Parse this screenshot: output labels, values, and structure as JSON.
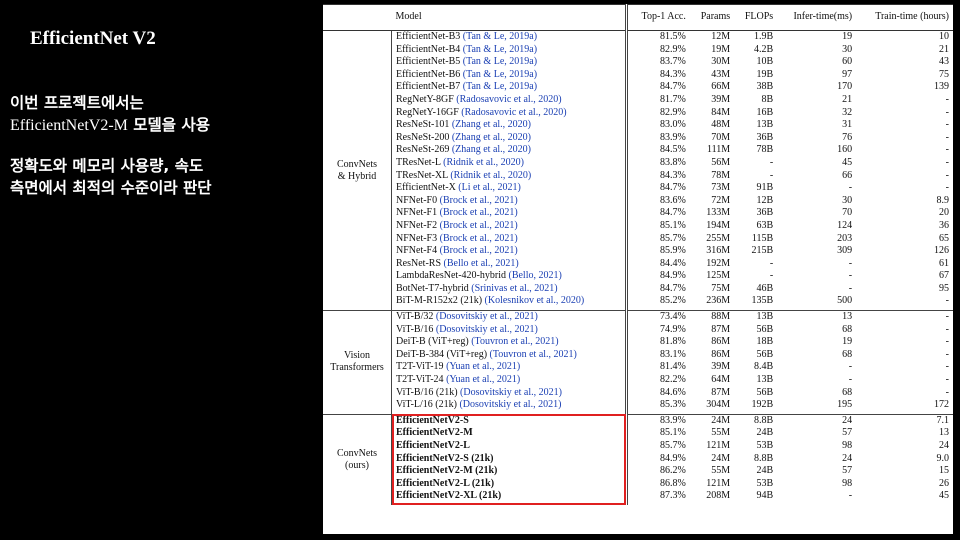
{
  "slide": {
    "title": "EfficientNet V2",
    "bullet1_line1": "이번 프로젝트에서는",
    "bullet1_model": "EfficientNetV2-M",
    "bullet1_rest": " 모델을 사용",
    "bullet2_line1": "정확도와 메모리 사용량, 속도",
    "bullet2_line2": "측면에서 최적의 수준이라 판단"
  },
  "table": {
    "headers": [
      "Model",
      "Top-1 Acc.",
      "Params",
      "FLOPs",
      "Infer-time(ms)",
      "Train-time (hours)"
    ],
    "groups": [
      {
        "label_lines": [
          "ConvNets",
          "& Hybrid"
        ],
        "rows": [
          {
            "model": "EfficientNet-B3",
            "cite": "(Tan & Le, 2019a)",
            "acc": "81.5%",
            "params": "12M",
            "flops": "1.9B",
            "infer": "19",
            "train": "10"
          },
          {
            "model": "EfficientNet-B4",
            "cite": "(Tan & Le, 2019a)",
            "acc": "82.9%",
            "params": "19M",
            "flops": "4.2B",
            "infer": "30",
            "train": "21"
          },
          {
            "model": "EfficientNet-B5",
            "cite": "(Tan & Le, 2019a)",
            "acc": "83.7%",
            "params": "30M",
            "flops": "10B",
            "infer": "60",
            "train": "43"
          },
          {
            "model": "EfficientNet-B6",
            "cite": "(Tan & Le, 2019a)",
            "acc": "84.3%",
            "params": "43M",
            "flops": "19B",
            "infer": "97",
            "train": "75"
          },
          {
            "model": "EfficientNet-B7",
            "cite": "(Tan & Le, 2019a)",
            "acc": "84.7%",
            "params": "66M",
            "flops": "38B",
            "infer": "170",
            "train": "139"
          },
          {
            "model": "RegNetY-8GF",
            "cite": "(Radosavovic et al., 2020)",
            "acc": "81.7%",
            "params": "39M",
            "flops": "8B",
            "infer": "21",
            "train": "-"
          },
          {
            "model": "RegNetY-16GF",
            "cite": "(Radosavovic et al., 2020)",
            "acc": "82.9%",
            "params": "84M",
            "flops": "16B",
            "infer": "32",
            "train": "-"
          },
          {
            "model": "ResNeSt-101",
            "cite": "(Zhang et al., 2020)",
            "acc": "83.0%",
            "params": "48M",
            "flops": "13B",
            "infer": "31",
            "train": "-"
          },
          {
            "model": "ResNeSt-200",
            "cite": "(Zhang et al., 2020)",
            "acc": "83.9%",
            "params": "70M",
            "flops": "36B",
            "infer": "76",
            "train": "-"
          },
          {
            "model": "ResNeSt-269",
            "cite": "(Zhang et al., 2020)",
            "acc": "84.5%",
            "params": "111M",
            "flops": "78B",
            "infer": "160",
            "train": "-"
          },
          {
            "model": "TResNet-L",
            "cite": "(Ridnik et al., 2020)",
            "acc": "83.8%",
            "params": "56M",
            "flops": "-",
            "infer": "45",
            "train": "-"
          },
          {
            "model": "TResNet-XL",
            "cite": "(Ridnik et al., 2020)",
            "acc": "84.3%",
            "params": "78M",
            "flops": "-",
            "infer": "66",
            "train": "-"
          },
          {
            "model": "EfficientNet-X",
            "cite": "(Li et al., 2021)",
            "acc": "84.7%",
            "params": "73M",
            "flops": "91B",
            "infer": "-",
            "train": "-"
          },
          {
            "model": "NFNet-F0",
            "cite": "(Brock et al., 2021)",
            "acc": "83.6%",
            "params": "72M",
            "flops": "12B",
            "infer": "30",
            "train": "8.9"
          },
          {
            "model": "NFNet-F1",
            "cite": "(Brock et al., 2021)",
            "acc": "84.7%",
            "params": "133M",
            "flops": "36B",
            "infer": "70",
            "train": "20"
          },
          {
            "model": "NFNet-F2",
            "cite": "(Brock et al., 2021)",
            "acc": "85.1%",
            "params": "194M",
            "flops": "63B",
            "infer": "124",
            "train": "36"
          },
          {
            "model": "NFNet-F3",
            "cite": "(Brock et al., 2021)",
            "acc": "85.7%",
            "params": "255M",
            "flops": "115B",
            "infer": "203",
            "train": "65"
          },
          {
            "model": "NFNet-F4",
            "cite": "(Brock et al., 2021)",
            "acc": "85.9%",
            "params": "316M",
            "flops": "215B",
            "infer": "309",
            "train": "126"
          },
          {
            "model": "ResNet-RS",
            "cite": "(Bello et al., 2021)",
            "acc": "84.4%",
            "params": "192M",
            "flops": "-",
            "infer": "-",
            "train": "61"
          },
          {
            "model": "LambdaResNet-420-hybrid",
            "cite": "(Bello, 2021)",
            "acc": "84.9%",
            "params": "125M",
            "flops": "-",
            "infer": "-",
            "train": "67"
          },
          {
            "model": "BotNet-T7-hybrid",
            "cite": "(Srinivas et al., 2021)",
            "acc": "84.7%",
            "params": "75M",
            "flops": "46B",
            "infer": "-",
            "train": "95"
          },
          {
            "model": "BiT-M-R152x2 (21k)",
            "cite": "(Kolesnikov et al., 2020)",
            "acc": "85.2%",
            "params": "236M",
            "flops": "135B",
            "infer": "500",
            "train": "-"
          }
        ]
      },
      {
        "label_lines": [
          "Vision",
          "Transformers"
        ],
        "rows": [
          {
            "model": "ViT-B/32",
            "cite": "(Dosovitskiy et al., 2021)",
            "acc": "73.4%",
            "params": "88M",
            "flops": "13B",
            "infer": "13",
            "train": "-"
          },
          {
            "model": "ViT-B/16",
            "cite": "(Dosovitskiy et al., 2021)",
            "acc": "74.9%",
            "params": "87M",
            "flops": "56B",
            "infer": "68",
            "train": "-"
          },
          {
            "model": "DeiT-B (ViT+reg)",
            "cite": "(Touvron et al., 2021)",
            "acc": "81.8%",
            "params": "86M",
            "flops": "18B",
            "infer": "19",
            "train": "-"
          },
          {
            "model": "DeiT-B-384 (ViT+reg)",
            "cite": "(Touvron et al., 2021)",
            "acc": "83.1%",
            "params": "86M",
            "flops": "56B",
            "infer": "68",
            "train": "-"
          },
          {
            "model": "T2T-ViT-19",
            "cite": "(Yuan et al., 2021)",
            "acc": "81.4%",
            "params": "39M",
            "flops": "8.4B",
            "infer": "-",
            "train": "-"
          },
          {
            "model": "T2T-ViT-24",
            "cite": "(Yuan et al., 2021)",
            "acc": "82.2%",
            "params": "64M",
            "flops": "13B",
            "infer": "-",
            "train": "-"
          },
          {
            "model": "ViT-B/16 (21k)",
            "cite": "(Dosovitskiy et al., 2021)",
            "acc": "84.6%",
            "params": "87M",
            "flops": "56B",
            "infer": "68",
            "train": "-"
          },
          {
            "model": "ViT-L/16 (21k)",
            "cite": "(Dosovitskiy et al., 2021)",
            "acc": "85.3%",
            "params": "304M",
            "flops": "192B",
            "infer": "195",
            "train": "172"
          }
        ]
      },
      {
        "label_lines": [
          "ConvNets",
          "(ours)"
        ],
        "bold": true,
        "rows": [
          {
            "model": "EfficientNetV2-S",
            "cite": "",
            "acc": "83.9%",
            "params": "24M",
            "flops": "8.8B",
            "infer": "24",
            "train": "7.1"
          },
          {
            "model": "EfficientNetV2-M",
            "cite": "",
            "acc": "85.1%",
            "params": "55M",
            "flops": "24B",
            "infer": "57",
            "train": "13"
          },
          {
            "model": "EfficientNetV2-L",
            "cite": "",
            "acc": "85.7%",
            "params": "121M",
            "flops": "53B",
            "infer": "98",
            "train": "24"
          },
          {
            "model": "EfficientNetV2-S (21k)",
            "cite": "",
            "acc": "84.9%",
            "params": "24M",
            "flops": "8.8B",
            "infer": "24",
            "train": "9.0"
          },
          {
            "model": "EfficientNetV2-M (21k)",
            "cite": "",
            "acc": "86.2%",
            "params": "55M",
            "flops": "24B",
            "infer": "57",
            "train": "15"
          },
          {
            "model": "EfficientNetV2-L (21k)",
            "cite": "",
            "acc": "86.8%",
            "params": "121M",
            "flops": "53B",
            "infer": "98",
            "train": "26"
          },
          {
            "model": "EfficientNetV2-XL (21k)",
            "cite": "",
            "acc": "87.3%",
            "params": "208M",
            "flops": "94B",
            "infer": "-",
            "train": "45"
          }
        ]
      }
    ]
  },
  "colors": {
    "background": "#000000",
    "citation": "#1a3fb3",
    "highlight_box": "#e02020"
  }
}
